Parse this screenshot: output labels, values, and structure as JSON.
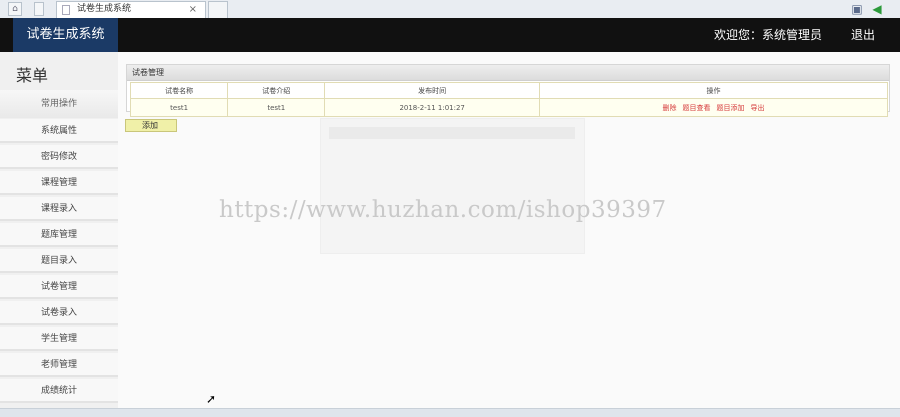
{
  "browser": {
    "tab_title": "试卷生成系统",
    "tab_close": "×"
  },
  "header": {
    "brand": "试卷生成系统",
    "welcome": "欢迎您：系统管理员",
    "logout": "退出"
  },
  "sidebar": {
    "title": "菜单",
    "group": "常用操作",
    "items": [
      {
        "label": "系统属性"
      },
      {
        "label": "密码修改"
      },
      {
        "label": "课程管理"
      },
      {
        "label": "课程录入"
      },
      {
        "label": "题库管理"
      },
      {
        "label": "题目录入"
      },
      {
        "label": "试卷管理"
      },
      {
        "label": "试卷录入"
      },
      {
        "label": "学生管理"
      },
      {
        "label": "老师管理"
      },
      {
        "label": "成绩统计"
      }
    ]
  },
  "main": {
    "panel_title": "试卷管理",
    "columns": [
      "试卷名称",
      "试卷介绍",
      "发布时间",
      "操作"
    ],
    "rows": [
      {
        "name": "test1",
        "intro": "test1",
        "time": "2018-2-11 1:01:27",
        "actions": [
          "删除",
          "题目查看",
          "题目添加",
          "导出"
        ]
      }
    ],
    "add_button": "添加"
  },
  "watermark": "https://www.huzhan.com/ishop39397",
  "colors": {
    "header_bg": "#111111",
    "brand_bg": "#1b3a66",
    "action_link": "#d63b3b",
    "add_button_bg": "#f0f0a8"
  }
}
